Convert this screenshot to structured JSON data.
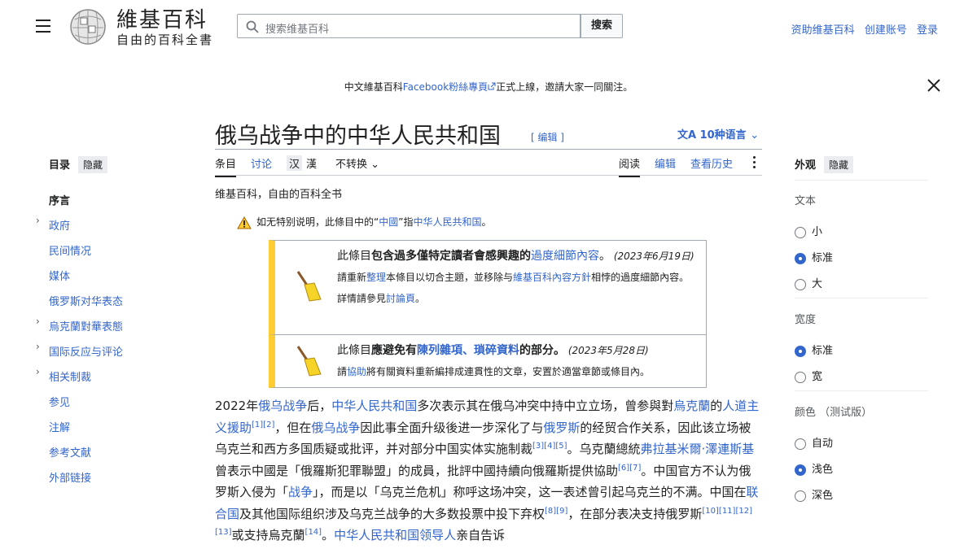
{
  "header": {
    "wordmark_main": "維基百科",
    "wordmark_sub": "自由的百科全書",
    "search_placeholder": "搜索维基百科",
    "search_button": "搜索",
    "links": [
      "资助维基百科",
      "创建账号",
      "登录"
    ]
  },
  "banner": {
    "prefix": "中文維基百科",
    "link": "Facebook粉絲專頁",
    "suffix": "正式上線，邀請大家一同關注。"
  },
  "article": {
    "title": "俄乌战争中的中华人民共和国",
    "edit_label": "[ 编辑 ]",
    "lang_button": "10种语言",
    "tabs_left": [
      "条目",
      "讨论",
      "汉",
      "漢",
      "不转换"
    ],
    "tabs_right": [
      "阅读",
      "编辑",
      "查看历史"
    ],
    "subtitle": "维基百科，自由的百科全书",
    "hatnote_pre": "如无特别说明，此條目中的“",
    "hatnote_link1": "中國",
    "hatnote_mid": "”指",
    "hatnote_link2": "中华人民共和国",
    "hatnote_post": "。"
  },
  "ambox1": {
    "pre": "此條目",
    "bold": "包含過多僅特定讀者會感興趣的",
    "link": "過度細節內容",
    "post": "。",
    "date": "(2023年6月19日)",
    "l2_pre": "請重新",
    "l2_link1": "整理",
    "l2_mid": "本條目以切合主題，並移除与",
    "l2_link2": "維基百科內容方針",
    "l2_post": "相悖的過度細節內容。詳情請參見",
    "l2_link3": "討論頁",
    "l2_end": "。"
  },
  "ambox2": {
    "pre": "此條目",
    "bold": "應避免有",
    "link": "陳列雜項、瑣碎資料",
    "post": "的部分。",
    "date": "(2023年5月28日)",
    "l2_pre": "請",
    "l2_link": "協助",
    "l2_post": "將有關資料重新編排成連貫性的文章，安置於適當章節或條目內。"
  },
  "toc": {
    "title": "目录",
    "hide": "隐藏",
    "items": [
      "序言",
      "政府",
      "民间情况",
      "媒体",
      "俄罗斯对华表态",
      "烏克蘭對華表態",
      "国际反应与评论",
      "相关制裁",
      "参见",
      "注解",
      "参考文献",
      "外部链接"
    ]
  },
  "appearance": {
    "title": "外观",
    "hide": "隐藏",
    "text_label": "文本",
    "text_options": [
      "小",
      "标准",
      "大"
    ],
    "width_label": "宽度",
    "width_options": [
      "标准",
      "宽"
    ],
    "color_label": "颜色 （测试版）",
    "color_options": [
      "自动",
      "浅色",
      "深色"
    ]
  },
  "body": {
    "t01": "2022年",
    "l01": "俄乌战争",
    "t02": "后，",
    "l02": "中华人民共和国",
    "t03": "多次表示其在俄乌冲突中持中立立场，曾参與對",
    "l03": "烏克蘭",
    "t04": "的",
    "l04": "人道主义援助",
    "r01": "[1][2]",
    "t05": "，但在",
    "l05": "俄乌战争",
    "t06": "因此事全面升级後进一步深化了与",
    "l06": "俄罗斯",
    "t07": "的经贸合作关系，因此该立场被乌克兰和西方多国质疑或批评，并对部分中国实体实施制裁",
    "r02": "[3][4][5]",
    "t08": "。乌克蘭總統",
    "l07": "弗拉基米爾·澤連斯基",
    "t09": "曾表示中國是「俄羅斯犯罪聯盟」的成員，批評中國持續向俄羅斯提供協助",
    "r03": "[6][7]",
    "t10": "。中国官方不认为俄罗斯入侵为「",
    "l08": "战争",
    "t11": "」，而是以「乌克兰危机」称呼这场冲突，这一表述曾引起乌克兰的不满。中国在",
    "l09": "联合国",
    "t12": "及其他国际组织涉及乌克兰战争的大多数投票中投下弃权",
    "r04": "[8][9]",
    "t13": "，在部分表决支持俄罗斯",
    "r05": "[10][11][12][13]",
    "t14": "或支持烏克蘭",
    "r06": "[14]",
    "t15": "。",
    "l10": "中华人民共和国领导人",
    "t16": "亲自告诉"
  },
  "colors": {
    "link": "#3366cc",
    "ambox_stripe": "#ffcc33"
  },
  "icons": [
    "menu-icon",
    "wikipedia-globe-icon",
    "search-icon",
    "external-link-icon",
    "close-icon",
    "translate-icon",
    "chevron-down-icon",
    "kebab-menu-icon",
    "warning-icon",
    "broom-icon"
  ]
}
